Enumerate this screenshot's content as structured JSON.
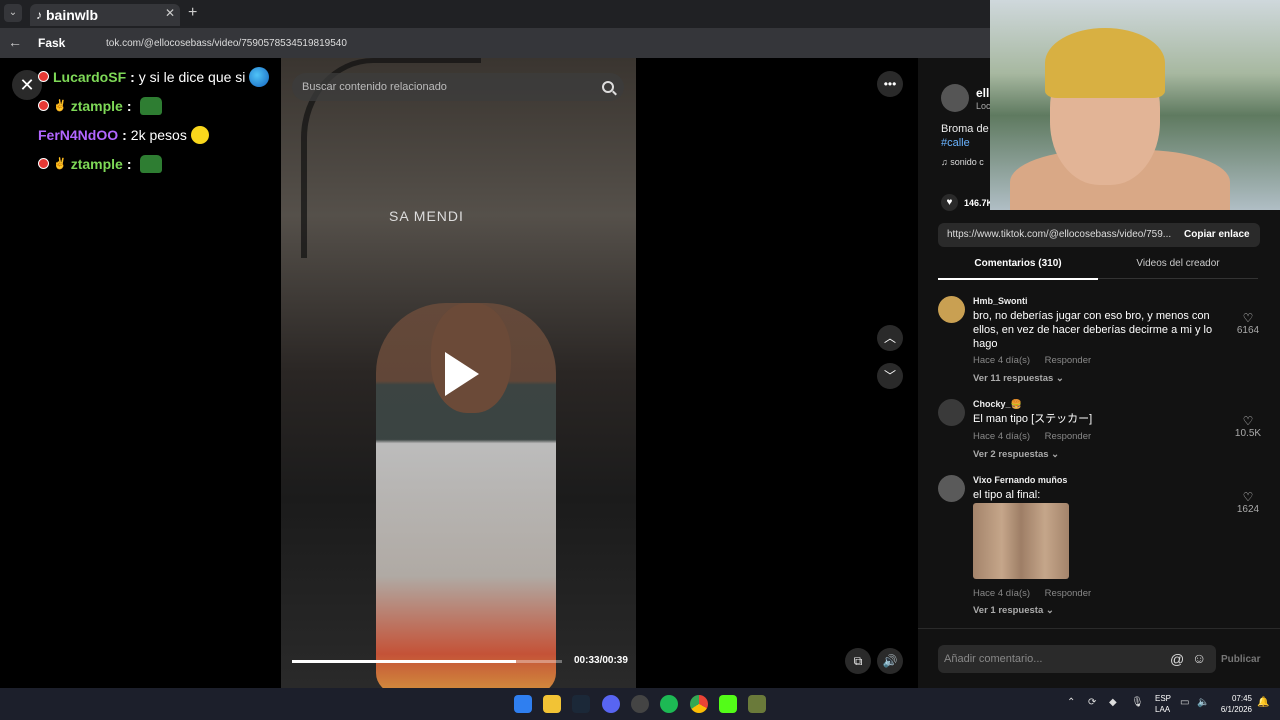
{
  "browser": {
    "tab_title": "bainwlb",
    "url": "tok.com/@ellocosebass/video/7590578534519819540",
    "url_badge": "Fask"
  },
  "chat": [
    {
      "user": "LucardoSF",
      "user_color": "#7ed957",
      "message": "y si le dice que si",
      "emote": "globe"
    },
    {
      "user": "ztample",
      "user_color": "#7ed957",
      "message": "",
      "emote": "green-frog"
    },
    {
      "user": "FerN4NdOO",
      "user_color": "#b266ff",
      "message": "2k pesos",
      "emote": "yellow-face"
    },
    {
      "user": "ztample",
      "user_color": "#7ed957",
      "message": "",
      "emote": "green-frog"
    }
  ],
  "video": {
    "search_placeholder": "Buscar contenido relacionado",
    "time": "00:33/00:39",
    "progress": 0.83,
    "sign_text": "SA MENDI"
  },
  "creator": {
    "name": "ell",
    "sub": "Loc",
    "description": "Broma de",
    "hashtag": "#calle",
    "sound": "♫ sonido c",
    "likes": "146.7K"
  },
  "share": {
    "link": "https://www.tiktok.com/@ellocosebass/video/759...",
    "copy_label": "Copiar enlace"
  },
  "tabs": {
    "comments": "Comentarios (310)",
    "videos": "Videos del creador"
  },
  "comments": [
    {
      "user": "Hmb_Swonti",
      "text": "bro, no deberías jugar con eso bro, y menos con ellos, en vez de hacer deberías decirme a mi y lo hago",
      "time": "Hace 4 día(s)",
      "reply": "Responder",
      "replies": "Ver 11 respuestas ⌄",
      "likes": "6164",
      "avatar_color": "#c9a052"
    },
    {
      "user": "Chocky_🍔",
      "text": "El man tipo [ステッカー]",
      "time": "Hace 4 día(s)",
      "reply": "Responder",
      "replies": "Ver 2 respuestas ⌄",
      "likes": "10.5K",
      "avatar_color": "#3a3a3a"
    },
    {
      "user": "Vixo Fernando muños",
      "text": "el tipo al final:",
      "time": "Hace 4 día(s)",
      "reply": "Responder",
      "replies": "Ver 1 respuesta ⌄",
      "likes": "1624",
      "avatar_color": "#5a5a5a"
    }
  ],
  "input": {
    "placeholder": "Añadir comentario...",
    "publish": "Publicar"
  },
  "taskbar": {
    "lang1": "ESP",
    "lang2": "LAA",
    "time": "07:45",
    "date": "6/1/2026"
  }
}
